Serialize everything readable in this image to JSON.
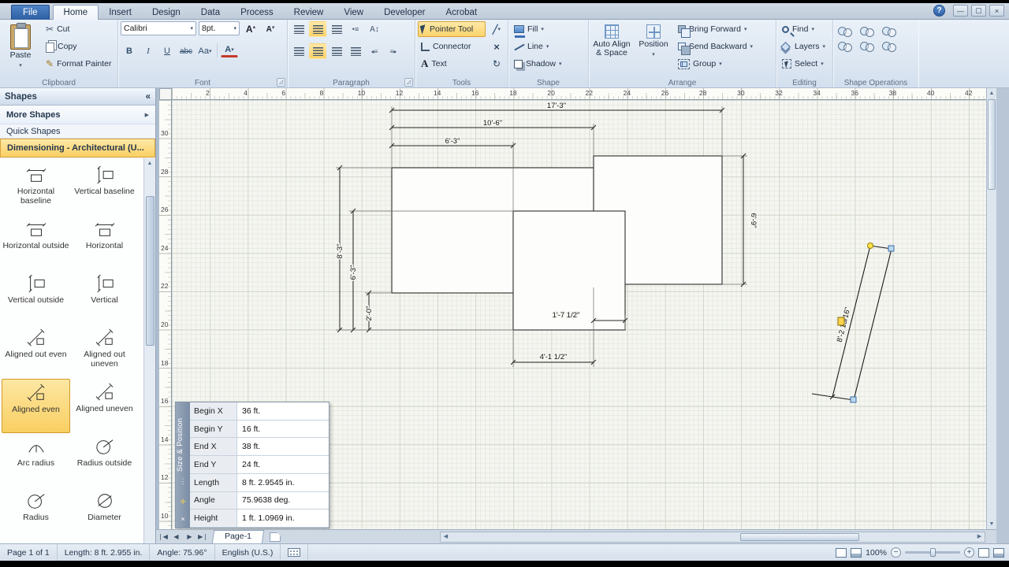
{
  "titlebar": {
    "tabs": [
      "File",
      "Home",
      "Insert",
      "Design",
      "Data",
      "Process",
      "Review",
      "View",
      "Developer",
      "Acrobat"
    ],
    "active_tab": "Home",
    "help": "?",
    "close": "×"
  },
  "ribbon": {
    "clipboard": {
      "label": "Clipboard",
      "paste": "Paste",
      "cut": "Cut",
      "copy": "Copy",
      "format_painter": "Format Painter"
    },
    "font": {
      "label": "Font",
      "family": "Calibri",
      "size": "8pt.",
      "bold": "B",
      "italic": "I",
      "underline": "U",
      "strikethrough": "abc",
      "case_toggle": "Aa",
      "font_color": "A"
    },
    "paragraph": {
      "label": "Paragraph"
    },
    "tools": {
      "label": "Tools",
      "pointer": "Pointer Tool",
      "connector": "Connector",
      "text": "Text"
    },
    "shape": {
      "label": "Shape",
      "fill": "Fill",
      "line": "Line",
      "shadow": "Shadow"
    },
    "arrange": {
      "label": "Arrange",
      "auto_align": "Auto Align & Space",
      "position": "Position",
      "bring_forward": "Bring Forward",
      "send_backward": "Send Backward",
      "group": "Group"
    },
    "editing": {
      "label": "Editing",
      "find": "Find",
      "layers": "Layers",
      "select": "Select"
    },
    "shape_ops": {
      "label": "Shape Operations"
    }
  },
  "shapes_panel": {
    "title": "Shapes",
    "collapse": "«",
    "more_shapes": "More Shapes",
    "more_arrow": "▶",
    "quick_shapes": "Quick Shapes",
    "stencil_title": "Dimensioning - Architectural (U...",
    "items": [
      {
        "label": "Horizontal baseline",
        "icon": "h"
      },
      {
        "label": "Vertical baseline",
        "icon": "v"
      },
      {
        "label": "Horizontal outside",
        "icon": "h"
      },
      {
        "label": "Horizontal",
        "icon": "h"
      },
      {
        "label": "Vertical outside",
        "icon": "v"
      },
      {
        "label": "Vertical",
        "icon": "v"
      },
      {
        "label": "Aligned out even",
        "icon": "aligned"
      },
      {
        "label": "Aligned out uneven",
        "icon": "aligned"
      },
      {
        "label": "Aligned even",
        "icon": "aligned",
        "selected": true
      },
      {
        "label": "Aligned uneven",
        "icon": "aligned"
      },
      {
        "label": "Arc radius",
        "icon": "arc"
      },
      {
        "label": "Radius outside",
        "icon": "radius"
      },
      {
        "label": "Radius",
        "icon": "radius"
      },
      {
        "label": "Diameter",
        "icon": "diameter"
      }
    ]
  },
  "rulers": {
    "top": [
      "2",
      "4",
      "6",
      "8",
      "10",
      "12",
      "14",
      "16",
      "18",
      "20",
      "22",
      "24",
      "26",
      "28",
      "30",
      "32",
      "34",
      "36",
      "38",
      "40",
      "42"
    ],
    "left": [
      "30",
      "28",
      "26",
      "24",
      "22",
      "20",
      "18",
      "16",
      "14",
      "12",
      "10"
    ]
  },
  "drawing": {
    "dims": {
      "total_width": "17'-3\"",
      "upper_width": "10'-6\"",
      "left_width": "6'-3\"",
      "overall_height": "8'-3\"",
      "mid_height": "6'-3\"",
      "small_height": "2'-0\"",
      "notch_width": "1'-7 1/2\"",
      "bottom_width": "4'-1 1/2\"",
      "right_height": "6'-9\"",
      "selected_length": "8'-2 15/16\""
    }
  },
  "size_position": {
    "title": "Size & Position",
    "rows": [
      {
        "label": "Begin X",
        "value": "36 ft."
      },
      {
        "label": "Begin Y",
        "value": "16 ft."
      },
      {
        "label": "End X",
        "value": "38 ft."
      },
      {
        "label": "End Y",
        "value": "24 ft."
      },
      {
        "label": "Length",
        "value": "8 ft. 2.9545 in."
      },
      {
        "label": "Angle",
        "value": "75.9638 deg."
      },
      {
        "label": "Height",
        "value": "1 ft. 1.0969 in."
      }
    ]
  },
  "page_bar": {
    "page_tab": "Page-1"
  },
  "status_bar": {
    "page_info": "Page 1 of 1",
    "length": "Length: 8 ft. 2.955 in.",
    "angle": "Angle: 75.96°",
    "language": "English (U.S.)",
    "zoom": "100%"
  }
}
